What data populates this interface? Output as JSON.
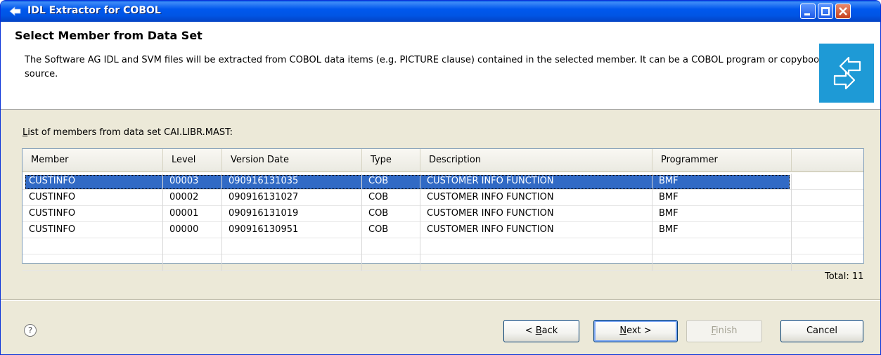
{
  "window": {
    "title": "IDL Extractor for COBOL"
  },
  "header": {
    "title": "Select Member from Data Set",
    "description": "The Software AG IDL and SVM files will be extracted from COBOL data items (e.g. PICTURE clause) contained in the selected member. It can be a COBOL program or copybook source."
  },
  "list": {
    "caption": "List of members from data set CAI.LIBR.MAST:",
    "columns": [
      "Member",
      "Level",
      "Version Date",
      "Type",
      "Description",
      "Programmer"
    ],
    "rows": [
      {
        "member": "CUSTINFO",
        "level": "00003",
        "version_date": "090916131035",
        "type": "COB",
        "description": "CUSTOMER INFO FUNCTION",
        "programmer": "BMF",
        "selected": true
      },
      {
        "member": "CUSTINFO",
        "level": "00002",
        "version_date": "090916131027",
        "type": "COB",
        "description": "CUSTOMER INFO FUNCTION",
        "programmer": "BMF",
        "selected": false
      },
      {
        "member": "CUSTINFO",
        "level": "00001",
        "version_date": "090916131019",
        "type": "COB",
        "description": "CUSTOMER INFO FUNCTION",
        "programmer": "BMF",
        "selected": false
      },
      {
        "member": "CUSTINFO",
        "level": "00000",
        "version_date": "090916130951",
        "type": "COB",
        "description": "CUSTOMER INFO FUNCTION",
        "programmer": "BMF",
        "selected": false
      }
    ],
    "total": "Total: 11"
  },
  "footer": {
    "help_icon": "help-icon",
    "back": {
      "prefix": "< ",
      "mnemonic": "B",
      "rest": "ack"
    },
    "next": {
      "mnemonic": "N",
      "rest": "ext >"
    },
    "finish": {
      "mnemonic": "F",
      "rest": "inish"
    },
    "cancel": "Cancel"
  },
  "colors": {
    "selection": "#316ac5",
    "banner": "#1e9ad6",
    "titlebar": "#0058ee"
  }
}
